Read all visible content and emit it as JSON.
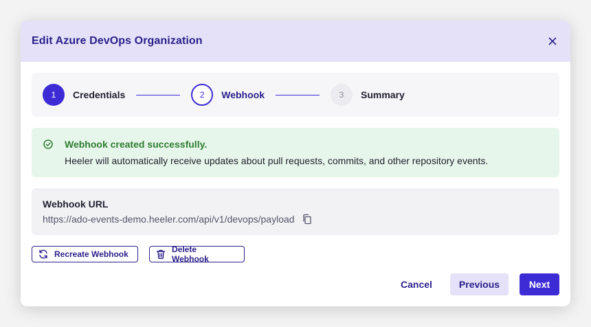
{
  "modal": {
    "title": "Edit Azure DevOps Organization"
  },
  "stepper": {
    "steps": [
      {
        "number": "1",
        "label": "Credentials",
        "state": "done"
      },
      {
        "number": "2",
        "label": "Webhook",
        "state": "active"
      },
      {
        "number": "3",
        "label": "Summary",
        "state": "pending"
      }
    ]
  },
  "alert": {
    "icon": "check-circle-icon",
    "title": "Webhook created successfully.",
    "message": "Heeler will automatically receive updates about pull requests, commits, and other repository events."
  },
  "webhook": {
    "label": "Webhook URL",
    "url": "https://ado-events-demo.heeler.com/api/v1/devops/payload",
    "copy_icon": "copy-icon"
  },
  "actions": {
    "recreate_label": "Recreate Webhook",
    "recreate_icon": "refresh-icon",
    "delete_label": "Delete Webhook",
    "delete_icon": "trash-icon"
  },
  "footer": {
    "cancel_label": "Cancel",
    "previous_label": "Previous",
    "next_label": "Next"
  },
  "colors": {
    "primary": "#3d2bd6",
    "primary_dark": "#2a1f8a",
    "header_bg": "#e4e1f8",
    "success_bg": "#e7f6ea",
    "success_text": "#2e7d32"
  }
}
